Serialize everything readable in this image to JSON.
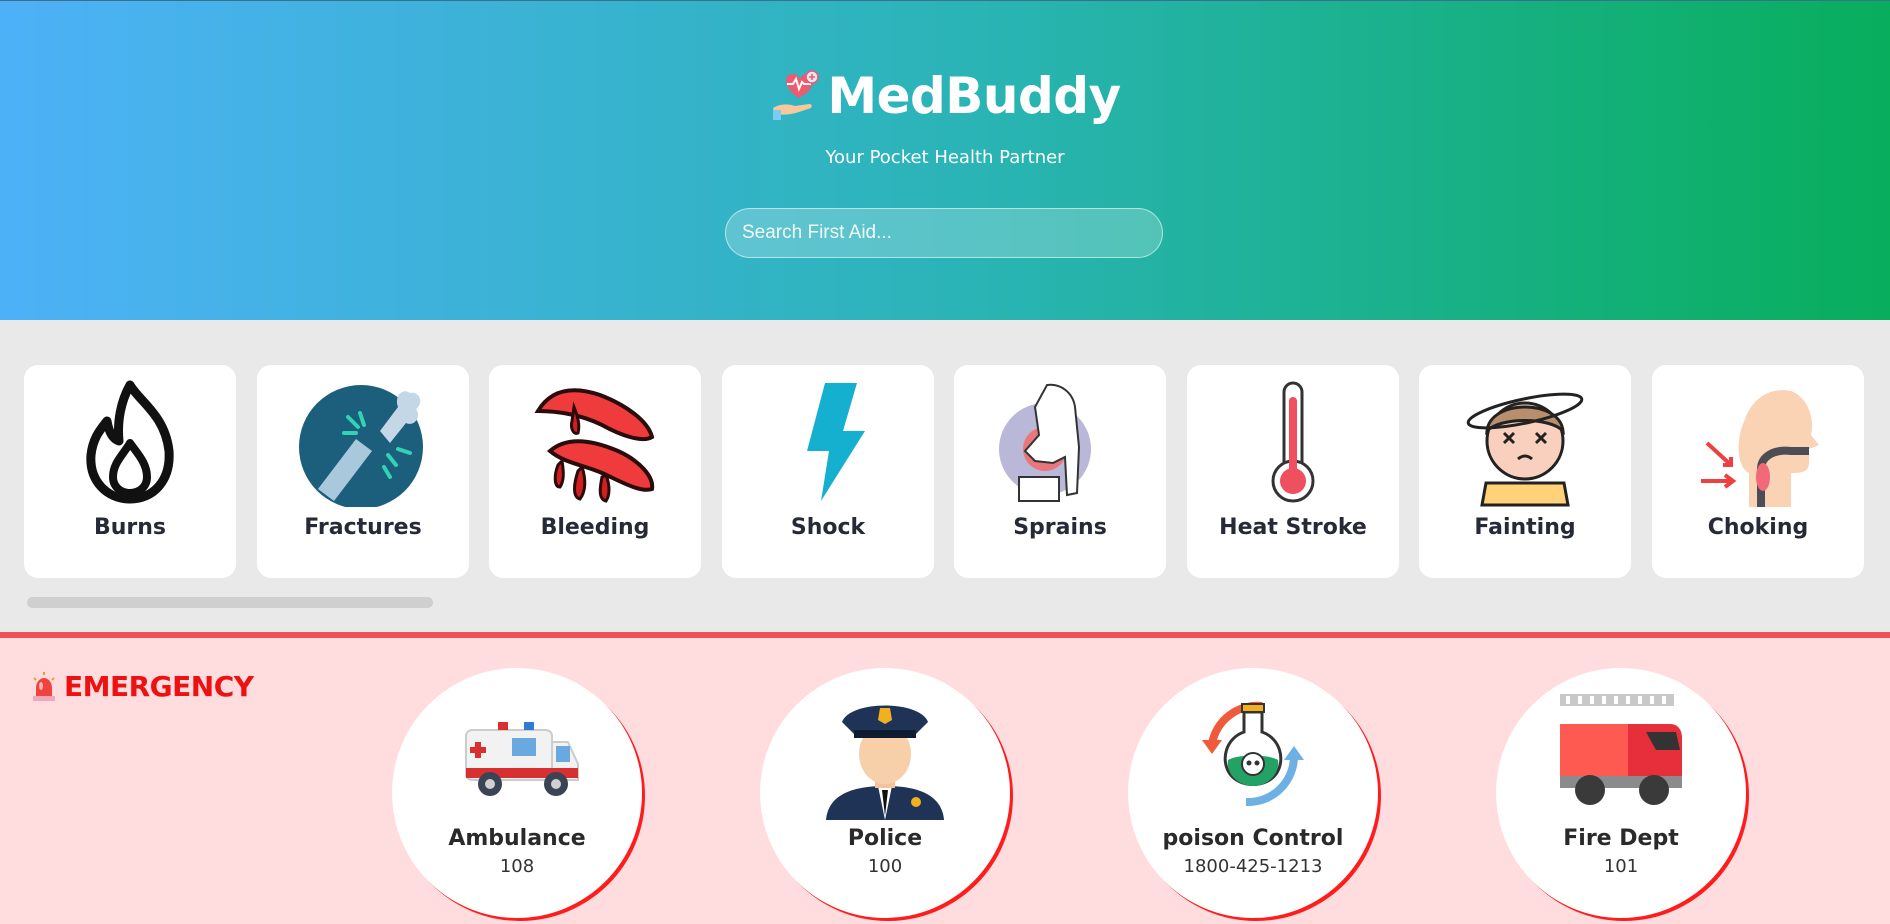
{
  "app": {
    "title": "MedBuddy",
    "tagline": "Your Pocket Health Partner",
    "logo_icon": "heart-hand-icon"
  },
  "search": {
    "placeholder": "Search First Aid...",
    "value": ""
  },
  "categories": [
    {
      "label": "Burns",
      "icon": "flame-icon"
    },
    {
      "label": "Fractures",
      "icon": "broken-bone-icon"
    },
    {
      "label": "Bleeding",
      "icon": "bleeding-icon"
    },
    {
      "label": "Shock",
      "icon": "lightning-icon"
    },
    {
      "label": "Sprains",
      "icon": "sprained-knee-icon"
    },
    {
      "label": "Heat Stroke",
      "icon": "thermometer-icon"
    },
    {
      "label": "Fainting",
      "icon": "dizzy-face-icon"
    },
    {
      "label": "Choking",
      "icon": "choking-throat-icon"
    }
  ],
  "emergency": {
    "title": "EMERGENCY",
    "icon": "siren-icon",
    "contacts": [
      {
        "name": "Ambulance",
        "number": "108",
        "icon": "ambulance-icon"
      },
      {
        "name": "Police",
        "number": "100",
        "icon": "police-officer-icon"
      },
      {
        "name": "poison Control",
        "number": "1800-425-1213",
        "icon": "poison-flask-icon"
      },
      {
        "name": "Fire Dept",
        "number": "101",
        "icon": "fire-truck-icon"
      }
    ]
  },
  "colors": {
    "header_gradient_start": "#4db1f7",
    "header_gradient_end": "#08ae5c",
    "emergency_red": "#ee1111",
    "emergency_bg": "#ffdcdd"
  }
}
